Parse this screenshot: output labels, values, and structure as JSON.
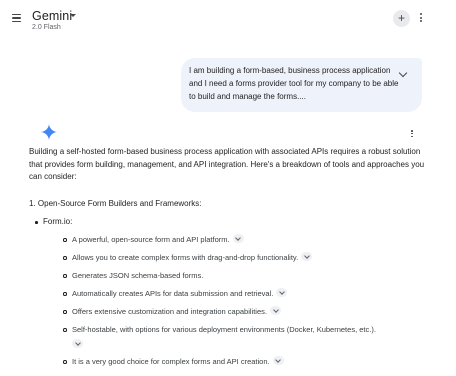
{
  "header": {
    "title": "Gemini",
    "model": "2.0 Flash",
    "icons": [
      "menu-icon",
      "dropdown-caret-icon",
      "new-chat-icon",
      "more-vert-icon"
    ]
  },
  "user_message": {
    "text": "I am building a form-based, business process application and I need a forms provider tool for my company to be able to build and manage the forms...."
  },
  "response": {
    "intro": "Building a self-hosted form-based business process application with associated APIs requires a robust solution that provides form building, management, and API integration. Here's a breakdown of tools and approaches you can consider:",
    "section_heading": "1. Open-Source Form Builders and Frameworks:",
    "tool_name": "Form.io:",
    "points": [
      "A powerful, open-source form and API platform.",
      "Allows you to create complex forms with drag-and-drop functionality.",
      "Generates JSON schema-based forms.",
      "Automatically creates APIs for data submission and retrieval.",
      "Offers extensive customization and integration capabilities.",
      "Self-hostable, with options for various deployment environments (Docker, Kubernetes, etc.).",
      "It is a very good choice for complex forms and API creation."
    ]
  },
  "colors": {
    "user_bubble": "#eef2fa",
    "gemini_star": "#4285f4",
    "text": "#1f1f1f"
  }
}
